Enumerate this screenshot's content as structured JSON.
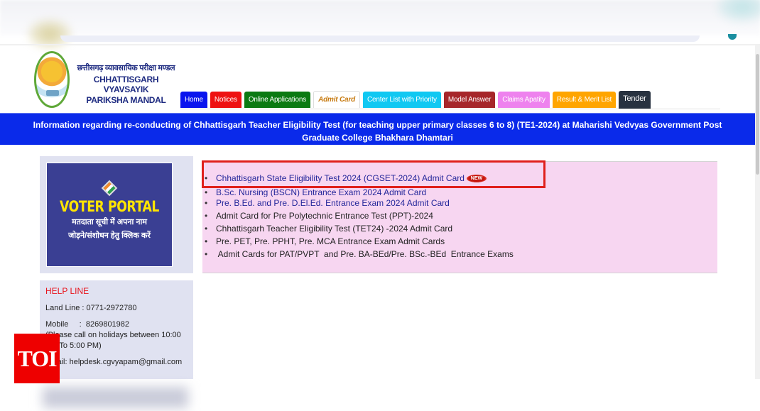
{
  "header": {
    "brand_hindi": "छत्तीसगढ़ व्यावसायिक परीक्षा मण्डल",
    "brand_line1": "CHHATTISGARH VYAVSAYIK",
    "brand_line2": "PARIKSHA MANDAL"
  },
  "nav": [
    {
      "label": "Home",
      "bg": "#0a14ee",
      "color": "#ffffff"
    },
    {
      "label": "Notices",
      "bg": "#ee1111",
      "color": "#ffffff"
    },
    {
      "label": "Online Applications",
      "bg": "#0b7a12",
      "color": "#ffffff"
    },
    {
      "label": "Admit Card",
      "bg": "#ffffff",
      "color": "#c77a10",
      "active": true
    },
    {
      "label": "Center List with Priority",
      "bg": "#10c8f2",
      "color": "#ffffff"
    },
    {
      "label": "Model Answer",
      "bg": "#a6262a",
      "color": "#ffffff"
    },
    {
      "label": "Claims Apatity",
      "bg": "#ee82ee",
      "color": "#ffffff"
    },
    {
      "label": "Result & Merit List",
      "bg": "#ffa500",
      "color": "#ffffff"
    },
    {
      "label": "Tender",
      "bg": "#283240",
      "color": "#ffffff"
    }
  ],
  "banner": {
    "text": "Information regarding re-conducting of Chhattisgarh Teacher Eligibility Test (for teaching upper primary classes 6 to 8) (TE1-2024) at Maharishi Vedvyas Government Post Graduate College Bhakhara Dhamtari"
  },
  "voter_portal": {
    "title": "VOTER PORTAL",
    "line1": "मतदाता सूची में अपना नाम",
    "line2": "जोड़ने/संशोधन हेतु क्लिक करें"
  },
  "helpline": {
    "title": "HELP LINE",
    "landline": "Land Line : 0771-2972780",
    "mobile": "Mobile     :  8269801982",
    "note": "(Please call on holidays between 10:00 AM To 5:00 PM)",
    "email": "Email:  helpdesk.cgvyapam@gmail.com"
  },
  "admit_cards": {
    "new_badge": "NEW",
    "items": [
      "Chhattisgarh State Eligibility Test 2024 (CGSET-2024) Admit Card",
      "B.Sc. Nursing (BSCN) Entrance Exam 2024 Admit Card",
      "Pre. B.Ed. and Pre. D.El.Ed. Entrance Exam 2024 Admit Card",
      "Admit Card for Pre Polytechnic Entrance Test (PPT)-2024",
      "Chhattisgarh Teacher Eligibility Test (TET24) -2024 Admit Card",
      "Pre. PET, Pre. PPHT, Pre. MCA Entrance Exam Admit Cards",
      " Admit Cards for PAT/PVPT  and Pre. BA-BEd/Pre. BSc.-BEd  Entrance Exams"
    ]
  },
  "overlay": {
    "toi_label": "TOI"
  }
}
